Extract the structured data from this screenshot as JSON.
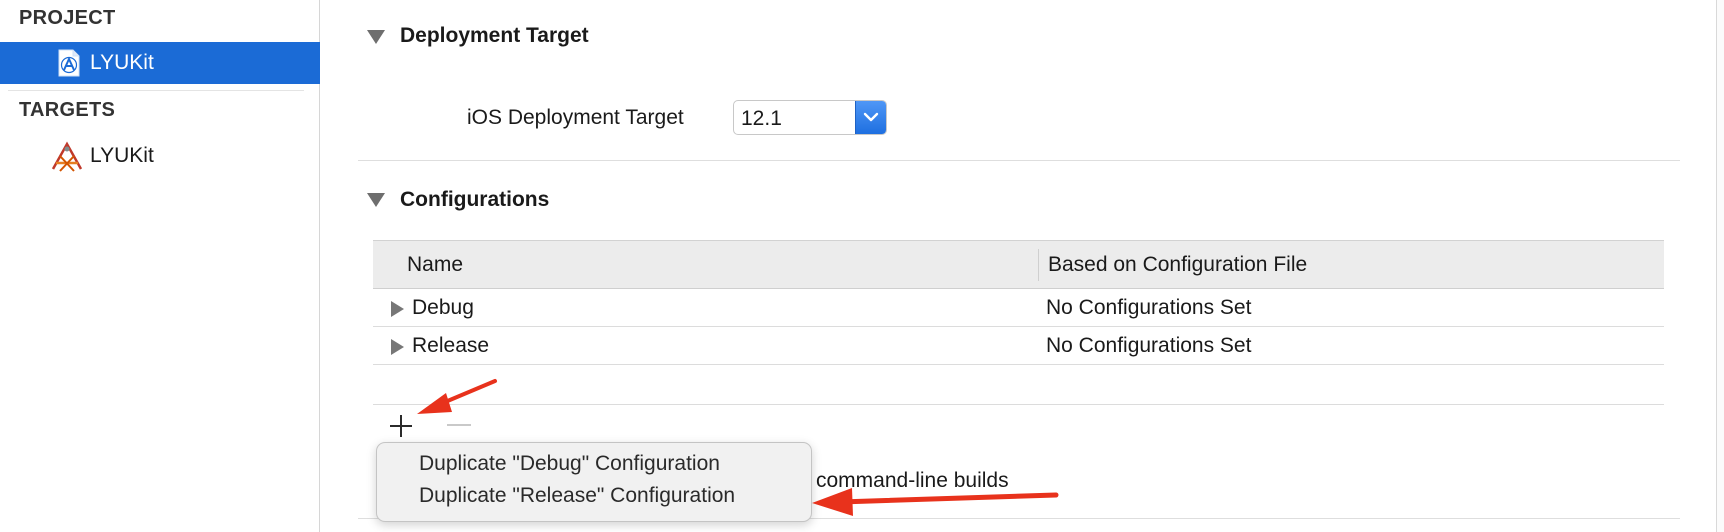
{
  "sidebar": {
    "project_header": "PROJECT",
    "project_items": [
      {
        "label": "LYUKit",
        "icon": "project-file-icon",
        "selected": true
      }
    ],
    "targets_header": "TARGETS",
    "target_items": [
      {
        "label": "LYUKit",
        "icon": "app-target-icon",
        "selected": false
      }
    ]
  },
  "deployment": {
    "title": "Deployment Target",
    "field_label": "iOS Deployment Target",
    "field_value": "12.1"
  },
  "configurations": {
    "title": "Configurations",
    "columns": [
      "Name",
      "Based on Configuration File"
    ],
    "rows": [
      {
        "name": "Debug",
        "file": "No Configurations Set"
      },
      {
        "name": "Release",
        "file": "No Configurations Set"
      }
    ],
    "add_icon": "plus-icon",
    "remove_icon": "minus-icon"
  },
  "menu": {
    "items": [
      "Duplicate \"Debug\" Configuration",
      "Duplicate \"Release\" Configuration"
    ]
  },
  "partial_text": "command-line builds",
  "colors": {
    "selection": "#1b6bd6",
    "popup_button": "#2a7be8",
    "annotation_arrow": "#e8321c"
  }
}
